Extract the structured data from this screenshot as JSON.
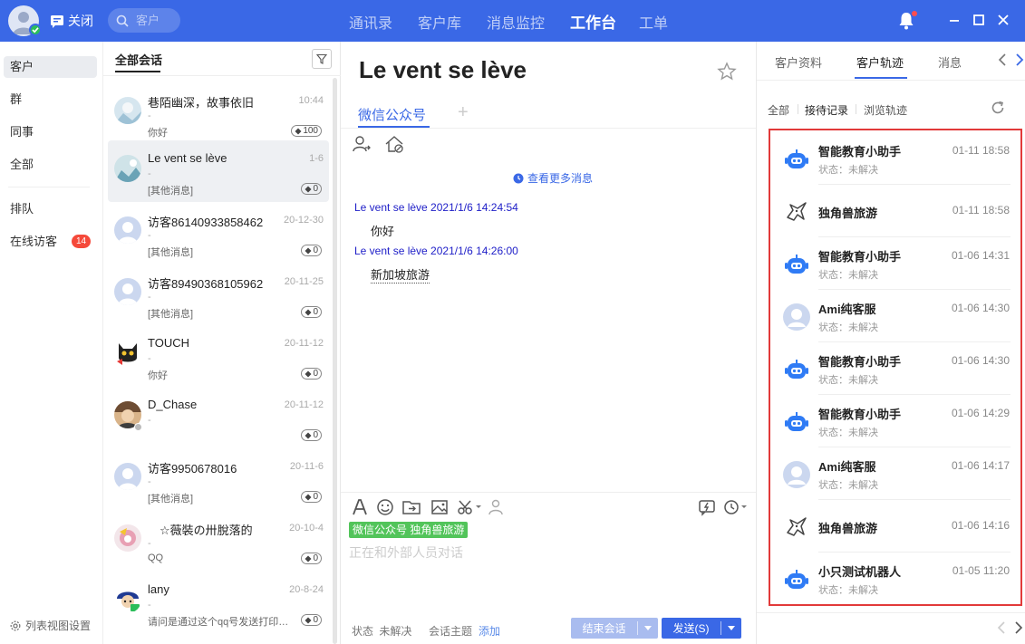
{
  "colors": {
    "brand": "#3a68e6",
    "accent_green": "#52c45a",
    "badge_red": "#f5493a",
    "highlight_border": "#e23a3a"
  },
  "topbar": {
    "close_label": "关闭",
    "search_placeholder": "客户",
    "nav": [
      {
        "label": "通讯录"
      },
      {
        "label": "客户库"
      },
      {
        "label": "消息监控"
      },
      {
        "label": "工作台",
        "active": true
      },
      {
        "label": "工单"
      }
    ],
    "icons": [
      "bell-icon",
      "minimize-icon",
      "maximize-icon",
      "close-icon"
    ]
  },
  "leftnav": {
    "items": [
      {
        "label": "客户",
        "active": true
      },
      {
        "label": "群"
      },
      {
        "label": "同事"
      },
      {
        "label": "全部"
      },
      {
        "label": "排队"
      },
      {
        "label": "在线访客",
        "badge": "14"
      }
    ],
    "settings_label": "列表视图设置"
  },
  "convlist": {
    "header": "全部会话",
    "items": [
      {
        "name": "巷陌幽深，故事依旧",
        "time": "10:44",
        "sub": "-",
        "msg": "你好",
        "count": "100"
      },
      {
        "name": "Le vent se lève",
        "time": "1-6",
        "sub": "-",
        "msg": "[其他消息]",
        "count": "0",
        "active": true
      },
      {
        "name": "访客86140933858462",
        "time": "20-12-30",
        "sub": "-",
        "msg": "[其他消息]",
        "count": "0"
      },
      {
        "name": "访客89490368105962",
        "time": "20-11-25",
        "sub": "-",
        "msg": "[其他消息]",
        "count": "0"
      },
      {
        "name": "TOUCH",
        "time": "20-11-12",
        "sub": "-",
        "msg": "你好",
        "count": "0"
      },
      {
        "name": "D_Chase",
        "time": "20-11-12",
        "sub": "-",
        "msg": "",
        "count": "0"
      },
      {
        "name": "访客9950678016",
        "time": "20-11-6",
        "sub": "-",
        "msg": "[其他消息]",
        "count": "0"
      },
      {
        "name": "　☆薇裝の卅脫落的",
        "time": "20-10-4",
        "sub": "-",
        "msg": "QQ",
        "count": "0"
      },
      {
        "name": "lany",
        "time": "20-8-24",
        "sub": "-",
        "msg": "请问是通过这个qq号发送打印机的吗",
        "count": "0"
      }
    ]
  },
  "chat": {
    "title": "Le vent se lève",
    "channel_tab": "微信公众号",
    "add_tab": "+",
    "more_messages": "查看更多消息",
    "messages": [
      {
        "header": "Le vent se lève 2021/1/6 14:24:54",
        "body": "你好"
      },
      {
        "header": "Le vent se lève 2021/1/6 14:26:00",
        "body": "新加坡旅游"
      }
    ],
    "channel_pill": "微信公众号 独角兽旅游",
    "input_placeholder": "正在和外部人员对话",
    "status_label": "状态",
    "status_value": "未解决",
    "topic_label": "会话主题",
    "topic_add": "添加",
    "end_button": "结束会话",
    "send_button": "发送(S)"
  },
  "right": {
    "tabs": [
      {
        "label": "客户资料"
      },
      {
        "label": "客户轨迹",
        "active": true
      },
      {
        "label": "消息"
      }
    ],
    "filters": [
      {
        "label": "全部"
      },
      {
        "label": "接待记录",
        "active": true
      },
      {
        "label": "浏览轨迹"
      }
    ],
    "tracks": [
      {
        "icon": "robot-icon",
        "title": "智能教育小助手",
        "time": "01-11 18:58",
        "status": "状态：未解决"
      },
      {
        "icon": "unicorn-icon",
        "title": "独角兽旅游",
        "time": "01-11 18:58",
        "status": ""
      },
      {
        "icon": "robot-icon",
        "title": "智能教育小助手",
        "time": "01-06 14:31",
        "status": "状态：未解决"
      },
      {
        "icon": "person-avatar-icon",
        "title": "Ami纯客服",
        "time": "01-06 14:30",
        "status": "状态：未解决"
      },
      {
        "icon": "robot-icon",
        "title": "智能教育小助手",
        "time": "01-06 14:30",
        "status": "状态：未解决"
      },
      {
        "icon": "robot-icon",
        "title": "智能教育小助手",
        "time": "01-06 14:29",
        "status": "状态：未解决"
      },
      {
        "icon": "person-avatar-icon",
        "title": "Ami纯客服",
        "time": "01-06 14:17",
        "status": "状态：未解决"
      },
      {
        "icon": "unicorn-icon",
        "title": "独角兽旅游",
        "time": "01-06 14:16",
        "status": ""
      },
      {
        "icon": "robot-icon",
        "title": "小只测试机器人",
        "time": "01-05 11:20",
        "status": "状态：未解决"
      }
    ]
  }
}
